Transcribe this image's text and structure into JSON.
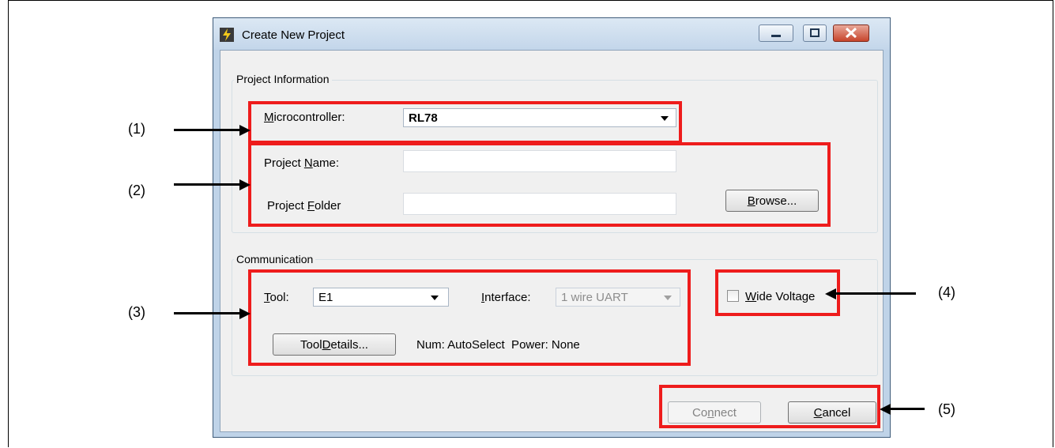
{
  "window": {
    "title": "Create New Project",
    "controls": [
      "minimize",
      "maximize",
      "close"
    ]
  },
  "project_information": {
    "group_label": "Project Information",
    "microcontroller": {
      "label_pre": "",
      "label_u": "M",
      "label_post": "icrocontroller:",
      "value": "RL78"
    },
    "project_name": {
      "label_pre": "Project ",
      "label_u": "N",
      "label_post": "ame:",
      "value": ""
    },
    "project_folder": {
      "label_pre": "Project ",
      "label_u": "F",
      "label_post": "older",
      "value": ""
    },
    "browse_button": {
      "pre": "",
      "u": "B",
      "post": "rowse..."
    }
  },
  "communication": {
    "group_label": "Communication",
    "tool": {
      "label_pre": "",
      "label_u": "T",
      "label_post": "ool:",
      "value": "E1"
    },
    "interface": {
      "label_pre": "",
      "label_u": "I",
      "label_post": "nterface:",
      "value": "1 wire UART"
    },
    "wide_voltage": {
      "pre": "",
      "u": "W",
      "post": "ide Voltage",
      "checked": false
    },
    "tool_details_button": {
      "pre": "Tool ",
      "u": "D",
      "post": "etails..."
    },
    "status": "Num: AutoSelect  Power: None"
  },
  "buttons": {
    "connect": {
      "pre": "Co",
      "u": "n",
      "post": "nect"
    },
    "cancel": {
      "pre": "",
      "u": "C",
      "post": "ancel"
    }
  },
  "callouts": [
    "(1)",
    "(2)",
    "(3)",
    "(4)",
    "(5)"
  ],
  "colors": {
    "highlight": "#ee1c1c",
    "client_bg": "#f0f0f0",
    "titlebar": "#c3d6ea"
  }
}
